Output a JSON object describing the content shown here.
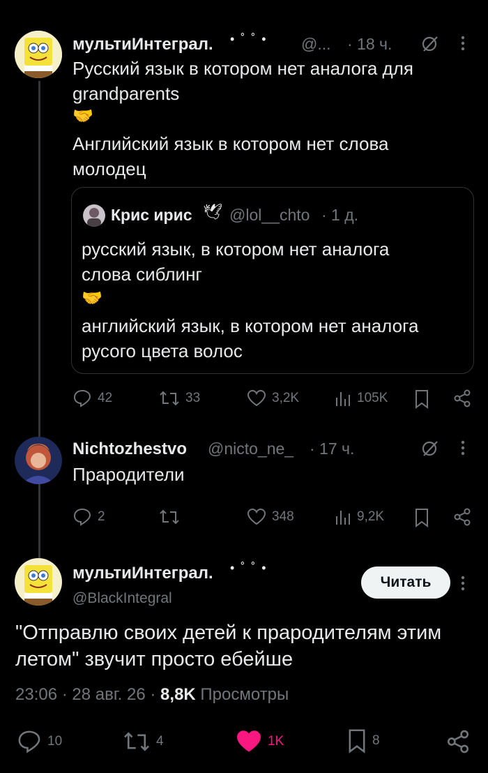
{
  "tweet1": {
    "name": "мультиИнтеграл.",
    "name_decor": "• ˚ ˚   •",
    "handle": "@...",
    "time": "· 18 ч.",
    "text_line1": "Русский язык в котором нет аналога для",
    "text_line2": "grandparents",
    "text_line3": "Английский язык в котором нет слова",
    "text_line4": "молодец",
    "emoji": "🤝",
    "quote": {
      "name": "Крис ирис",
      "handle": "@lol__chto",
      "time": "· 1 д.",
      "emoji_name": "🕊",
      "line1": "русский язык, в котором нет аналога",
      "line2": "слова сиблинг",
      "line3": "английский язык, в котором нет аналога",
      "line4": "русого цвета волос",
      "emoji": "🤝"
    },
    "actions": {
      "replies": "42",
      "reposts": "33",
      "likes": "3,2K",
      "views": "105K"
    }
  },
  "tweet2": {
    "name": "Nichtozhestvo",
    "handle": "@nicto_ne_",
    "time": "· 17 ч.",
    "text": "Прародители",
    "actions": {
      "replies": "2",
      "reposts": "",
      "likes": "348",
      "views": "9,2K"
    }
  },
  "tweet3": {
    "name": "мультиИнтеграл.",
    "name_decor": "• ˚ ˚   •",
    "handle": "@BlackIntegral",
    "read_button": "Читать",
    "text_line1": "\"Отправлю своих детей к прародителям этим",
    "text_line2": "летом\" звучит просто ебейше",
    "timestamp": "23:06 · 28 авг. 26 ·",
    "views_count": "8,8K",
    "views_label": "Просмотры",
    "actions": {
      "replies": "10",
      "reposts": "4",
      "likes": "1K",
      "bookmarks": "8"
    }
  },
  "colors": {
    "like_active": "#f91880",
    "muted": "#71767b",
    "text": "#e7e9ea"
  },
  "icons": [
    "reply-icon",
    "repost-icon",
    "like-icon",
    "views-icon",
    "bookmark-icon",
    "share-icon",
    "grok-icon",
    "more-icon"
  ]
}
